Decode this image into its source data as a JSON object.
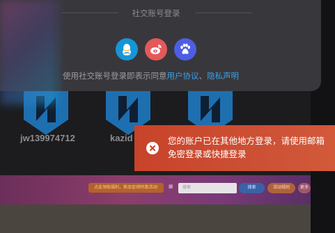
{
  "social_login": {
    "title": "社交账号登录",
    "providers": [
      {
        "name": "qq-icon"
      },
      {
        "name": "weibo-icon"
      },
      {
        "name": "baidu-icon"
      }
    ],
    "agreement_prefix": "使用社交账号登录即表示同意",
    "user_agreement_link": "用户协议",
    "separator": "、",
    "privacy_link": "隐私声明"
  },
  "background_users": [
    {
      "name": "jw139974712"
    },
    {
      "name": "kazid"
    }
  ],
  "banner": {
    "notice": "点此领取福利，新品促销特惠活动!",
    "search_placeholder": "搜索",
    "button_1": "搜索",
    "button_2": "活动规则",
    "button_3": "更多"
  },
  "toast": {
    "message": "您的账户已在其他地方登录，请使用邮箱免密登录或快捷登录"
  },
  "colors": {
    "toast_bg": "#c8432a",
    "link": "#3a9fe6",
    "qq": "#1596d8",
    "weibo": "#e4585a",
    "baidu": "#4d5ee5"
  }
}
